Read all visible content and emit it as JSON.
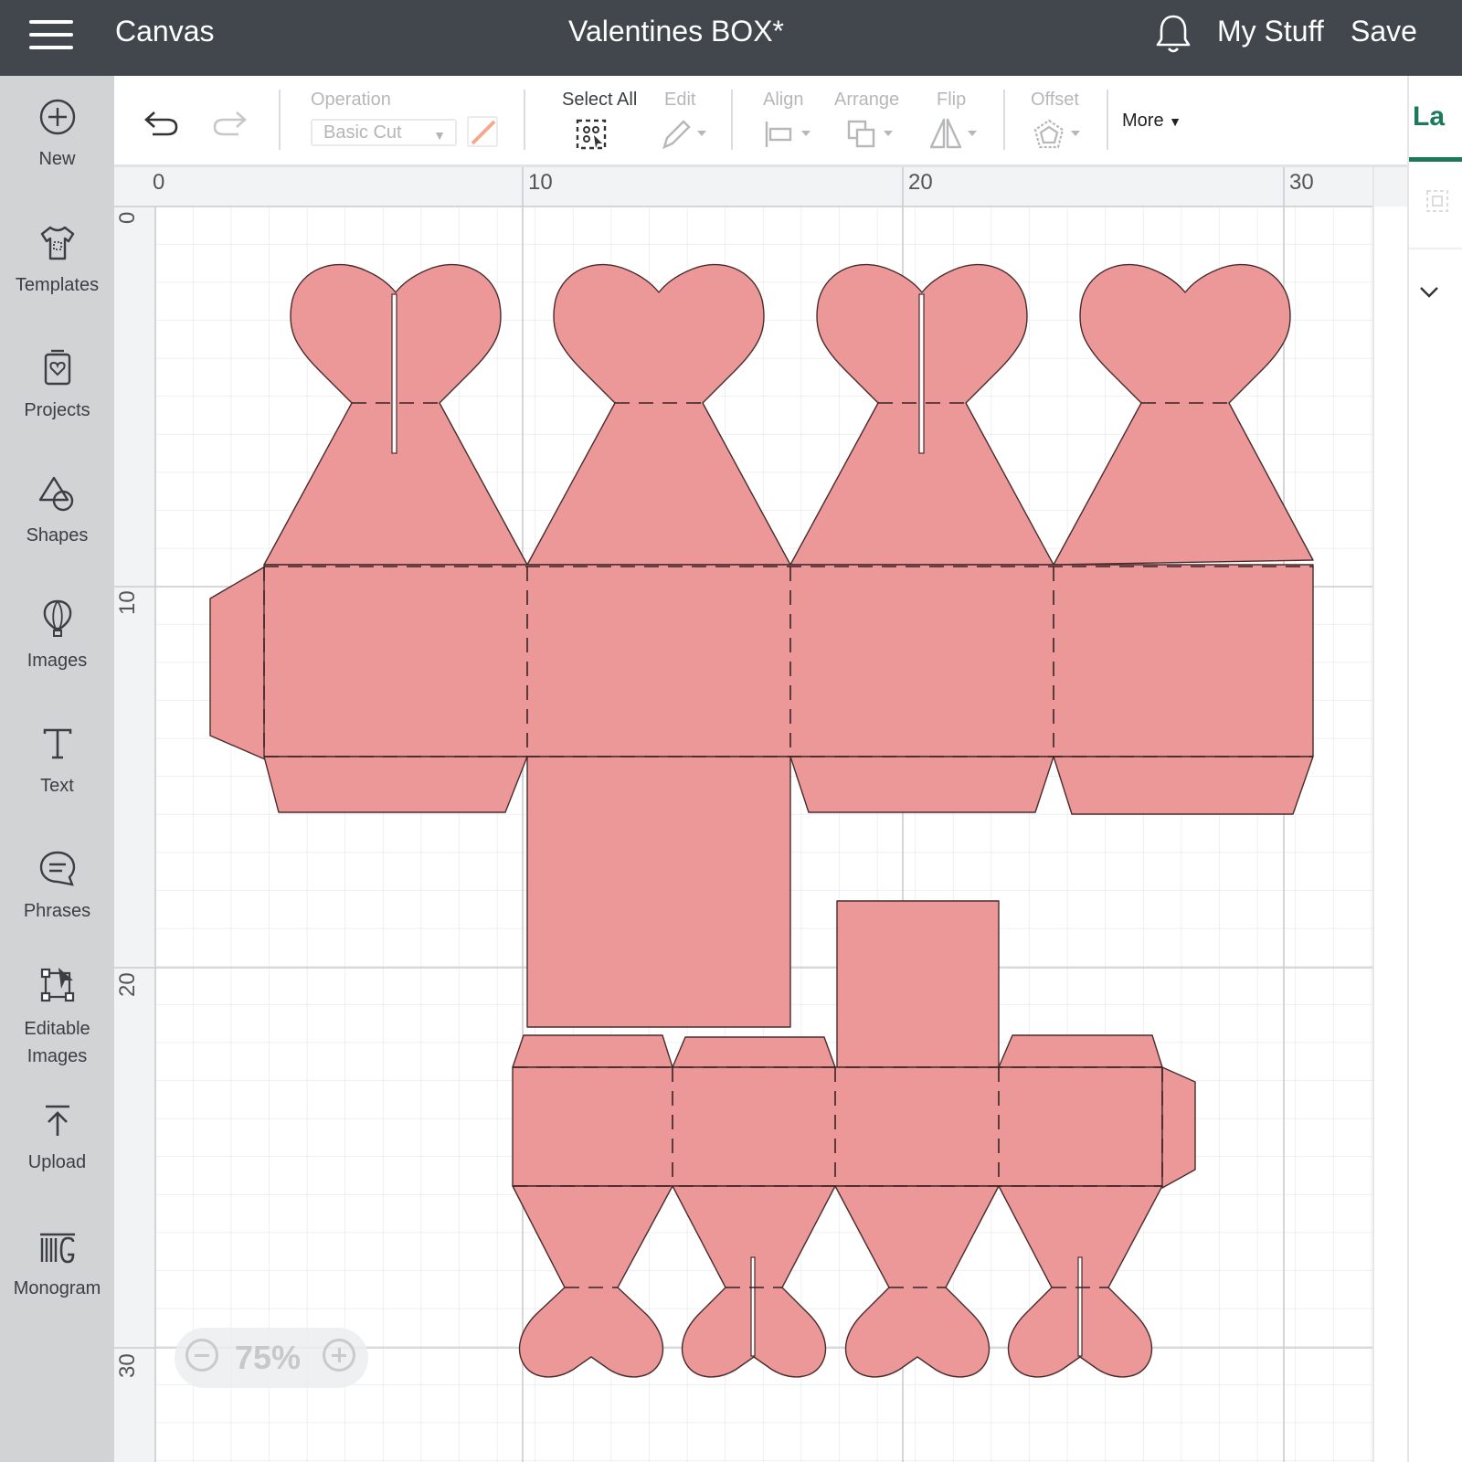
{
  "app": {
    "section": "Canvas",
    "document_title": "Valentines BOX*"
  },
  "header": {
    "my_stuff": "My Stuff",
    "save": "Save"
  },
  "sidebar": {
    "items": [
      {
        "label": "New",
        "icon": "plus-circle-icon"
      },
      {
        "label": "Templates",
        "icon": "tshirt-icon"
      },
      {
        "label": "Projects",
        "icon": "projects-icon"
      },
      {
        "label": "Shapes",
        "icon": "shapes-icon"
      },
      {
        "label": "Images",
        "icon": "balloon-icon"
      },
      {
        "label": "Text",
        "icon": "text-icon"
      },
      {
        "label": "Phrases",
        "icon": "speech-bubble-icon"
      },
      {
        "label": "Editable Images",
        "line1": "Editable",
        "line2": "Images",
        "icon": "vector-edit-icon"
      },
      {
        "label": "Upload",
        "icon": "upload-icon"
      },
      {
        "label": "Monogram",
        "icon": "monogram-icon"
      }
    ]
  },
  "toolbar": {
    "operation_label": "Operation",
    "operation_value": "Basic Cut",
    "select_all": "Select All",
    "edit": "Edit",
    "align": "Align",
    "arrange": "Arrange",
    "flip": "Flip",
    "offset": "Offset",
    "more": "More",
    "accent_color": "#f4a98f"
  },
  "right_panel": {
    "tab_partial": "La",
    "accent": "#1a7a5a"
  },
  "canvas": {
    "ruler_top": [
      "0",
      "10",
      "20",
      "30"
    ],
    "ruler_left": [
      "0",
      "10",
      "20",
      "30"
    ],
    "zoom": "75%",
    "shape_fill": "#ec9898",
    "shape_stroke": "#4a2b2b"
  }
}
